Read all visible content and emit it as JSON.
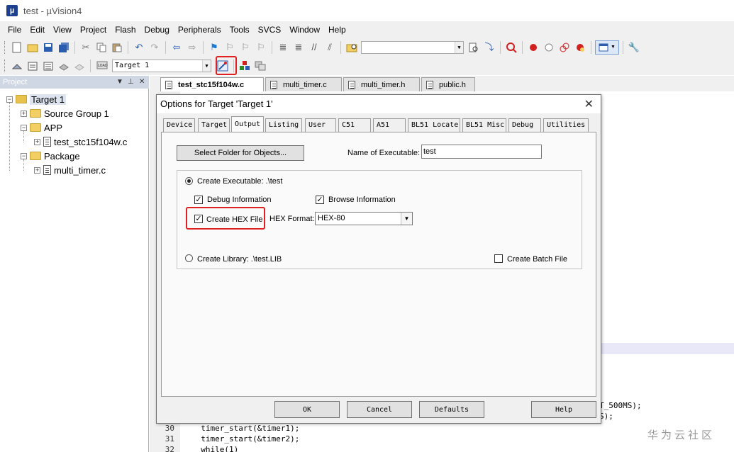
{
  "window": {
    "title": "test  - µVision4"
  },
  "menu": [
    "File",
    "Edit",
    "View",
    "Project",
    "Flash",
    "Debug",
    "Peripherals",
    "Tools",
    "SVCS",
    "Window",
    "Help"
  ],
  "toolbar": {
    "target_select": "Target 1"
  },
  "project_panel": {
    "title": "Project",
    "tree": {
      "root": "Target 1",
      "source_group": "Source Group 1",
      "app": "APP",
      "app_file": "test_stc15f104w.c",
      "package": "Package",
      "package_file": "multi_timer.c"
    }
  },
  "editor": {
    "tabs": [
      "test_stc15f104w.c",
      "multi_timer.c",
      "multi_timer.h",
      "public.h"
    ],
    "active_tab": "test_stc15f104w.c",
    "lines": [
      {
        "no": "",
        "text": "T_500MS);"
      },
      {
        "no": "",
        "text": "S);"
      },
      {
        "no": "30",
        "text": "  timer_start(&timer1);"
      },
      {
        "no": "31",
        "text": "  timer_start(&timer2);"
      },
      {
        "no": "32",
        "text": "  while(1)"
      }
    ]
  },
  "dialog": {
    "title": "Options for Target 'Target 1'",
    "tabs": [
      "Device",
      "Target",
      "Output",
      "Listing",
      "User",
      "C51",
      "A51",
      "BL51 Locate",
      "BL51 Misc",
      "Debug",
      "Utilities"
    ],
    "active_tab": "Output",
    "select_folder_button": "Select Folder for Objects...",
    "name_of_executable_label": "Name of Executable:",
    "name_of_executable_value": "test",
    "create_executable_label": "Create Executable:  .\\test",
    "debug_info_label": "Debug Information",
    "browse_info_label": "Browse Information",
    "create_hex_label": "Create HEX File",
    "hex_format_label": "HEX Format:",
    "hex_format_value": "HEX-80",
    "create_library_label": "Create Library:  .\\test.LIB",
    "create_batch_label": "Create Batch File",
    "checks": {
      "debug_info": true,
      "browse_info": true,
      "create_hex": true,
      "create_batch": false
    },
    "radio_selected": "create_executable",
    "buttons": {
      "ok": "OK",
      "cancel": "Cancel",
      "defaults": "Defaults",
      "help": "Help"
    }
  },
  "watermark": "华为云社区",
  "colors": {
    "highlight_red": "#e02020",
    "panel_header": "#cfd6e4",
    "dialog_bg": "#f0f0f0"
  }
}
